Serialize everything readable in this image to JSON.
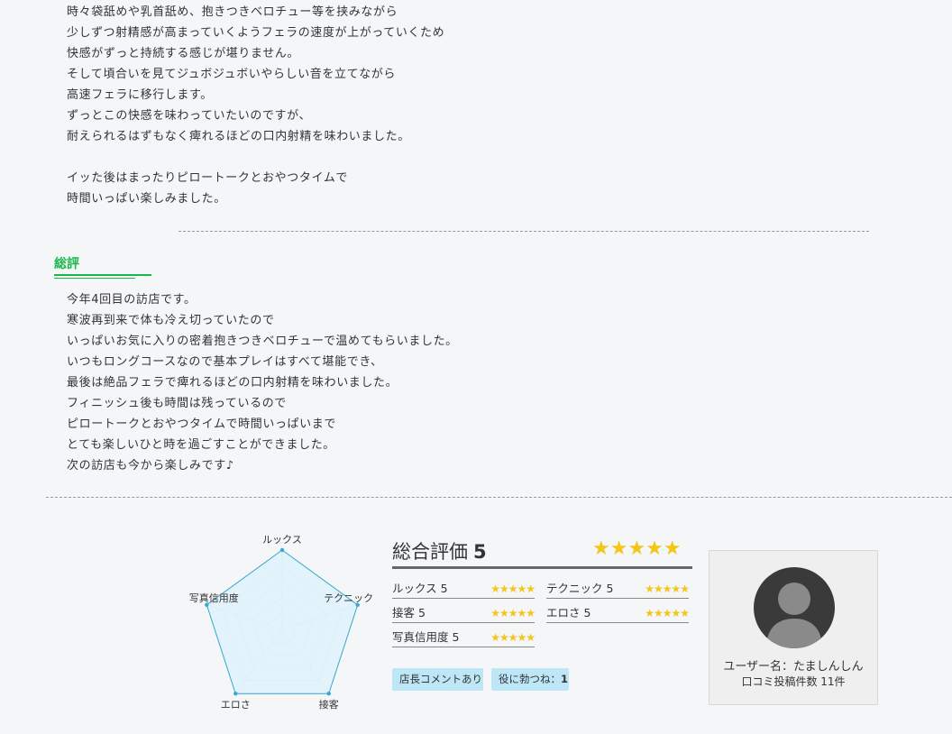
{
  "body_text": {
    "lines": [
      "時々袋舐めや乳首舐め、抱きつきベロチュー等を挟みながら",
      "少しずつ射精感が高まっていくようフェラの速度が上がっていくため",
      "快感がずっと持続する感じが堪りません。",
      "そして頃合いを見てジュボジュボいやらしい音を立てながら",
      "高速フェラに移行します。",
      "ずっとこの快感を味わっていたいのですが、",
      "耐えられるはずもなく痺れるほどの口内射精を味わいました。",
      "",
      "イッた後はまったりピロートークとおやつタイムで",
      "時間いっぱい楽しみました。"
    ]
  },
  "summary": {
    "heading": "総評",
    "lines": [
      "今年4回目の訪店です。",
      "寒波再到来で体も冷え切っていたので",
      "いっぱいお気に入りの密着抱きつきベロチューで温めてもらいました。",
      "いつもロングコースなので基本プレイはすべて堪能でき、",
      "最後は絶品フェラで痺れるほどの口内射精を味わいました。",
      "フィニッシュ後も時間は残っているので",
      "ピロートークとおやつタイムで時間いっぱいまで",
      "とても楽しいひと時を過ごすことができました。",
      "次の訪店も今から楽しみです♪"
    ]
  },
  "radar": {
    "labels": [
      "ルックス",
      "テクニック",
      "接客",
      "エロさ",
      "写真信用度"
    ],
    "values": [
      5,
      5,
      5,
      5,
      5
    ],
    "max": 5,
    "fill_color": "#dff2fb",
    "line_color": "#38a8d0"
  },
  "rating": {
    "overall_label": "総合評価",
    "overall_value": "5",
    "overall_stars": "★★★★★",
    "categories": [
      {
        "name": "ルックス 5",
        "stars": "★★★★★"
      },
      {
        "name": "テクニック 5",
        "stars": "★★★★★"
      },
      {
        "name": "接客 5",
        "stars": "★★★★★"
      },
      {
        "name": "エロさ 5",
        "stars": "★★★★★"
      },
      {
        "name": "写真信用度 5",
        "stars": "★★★★★"
      }
    ]
  },
  "badges": {
    "shop_comment": "店長コメントあり",
    "helpful_label": "役に勃つね：",
    "helpful_count": "1"
  },
  "user": {
    "name": "ユーザー名：たましんしん",
    "post_count": "口コミ投稿件数 11件"
  },
  "colors": {
    "accent_green": "#19b84a",
    "star_yellow": "#f5c518",
    "badge_blue": "#bde7f7"
  }
}
